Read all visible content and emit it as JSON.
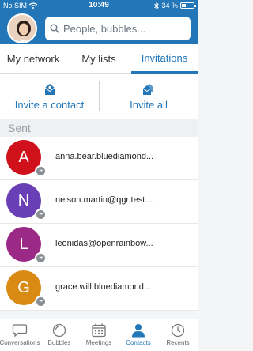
{
  "status_bar": {
    "carrier": "No SIM",
    "time": "10:49",
    "battery": "34 %",
    "battery_level": 0.34
  },
  "search": {
    "placeholder": "People, bubbles..."
  },
  "tabs": [
    {
      "label": "My network",
      "active": false
    },
    {
      "label": "My lists",
      "active": false
    },
    {
      "label": "Invitations",
      "active": true
    }
  ],
  "actions": {
    "invite_contact": "Invite a contact",
    "invite_all": "Invite all"
  },
  "section": {
    "title": "Sent"
  },
  "invitations": [
    {
      "initial": "A",
      "email": "anna.bear.bluediamond...",
      "color": "#d0101b"
    },
    {
      "initial": "N",
      "email": "nelson.martin@qgr.test....",
      "color": "#6a3fb5"
    },
    {
      "initial": "L",
      "email": "leonidas@openrainbow...",
      "color": "#9b2a86"
    },
    {
      "initial": "G",
      "email": "grace.will.bluediamond...",
      "color": "#d98a12"
    }
  ],
  "bottom_nav": [
    {
      "label": "Conversations",
      "icon": "chat-icon",
      "active": false
    },
    {
      "label": "Bubbles",
      "icon": "bubble-icon",
      "active": false
    },
    {
      "label": "Meetings",
      "icon": "calendar-icon",
      "active": false
    },
    {
      "label": "Contacts",
      "icon": "person-icon",
      "active": true
    },
    {
      "label": "Recents",
      "icon": "clock-icon",
      "active": false
    }
  ],
  "colors": {
    "brand": "#2377b8"
  }
}
